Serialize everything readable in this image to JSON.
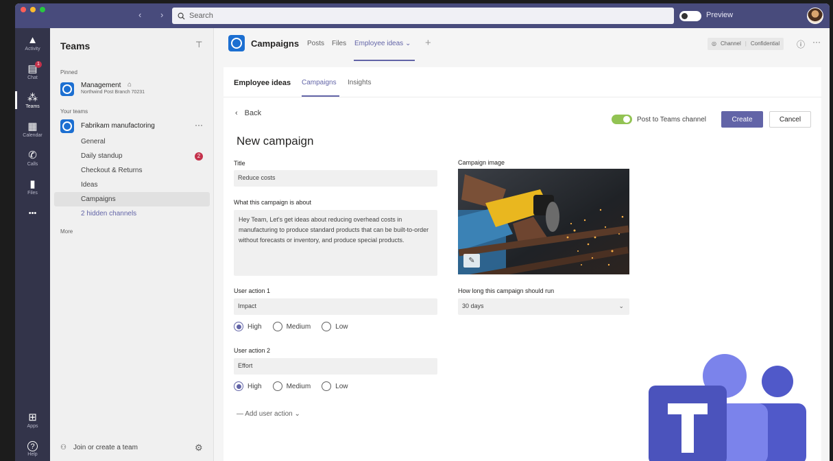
{
  "titlebar": {
    "search_placeholder": "Search",
    "preview_label": "Preview",
    "nav_arrows": "‹ ›"
  },
  "rail": [
    {
      "icon": "bell-icon",
      "glyph": "🔔",
      "label": "Activity"
    },
    {
      "icon": "chat-icon",
      "glyph": "▤",
      "label": "Chat",
      "badge": "1"
    },
    {
      "icon": "teams-icon",
      "glyph": "⁂",
      "label": "Teams"
    },
    {
      "icon": "calendar-icon",
      "glyph": "▦",
      "label": "Calendar"
    },
    {
      "icon": "calls-icon",
      "glyph": "✆",
      "label": "Calls"
    },
    {
      "icon": "files-icon",
      "glyph": "▮",
      "label": "Files"
    },
    {
      "icon": "more-apps-icon",
      "glyph": "•••",
      "label": ""
    },
    {
      "icon": "apps-icon",
      "glyph": "⊞",
      "label": "Apps"
    },
    {
      "icon": "help-icon",
      "glyph": "?",
      "label": "Help"
    }
  ],
  "team_panel": {
    "title": "Teams",
    "pinned_label": "Pinned",
    "pinned_team": {
      "name": "Management",
      "sub": "Northwind Post Branch 70231"
    },
    "your_teams_label": "Your teams",
    "team": {
      "name": "Fabrikam manufactoring",
      "more": "···"
    },
    "channels": [
      {
        "label": "General"
      },
      {
        "label": "Daily standup",
        "badge": "2"
      },
      {
        "label": "Checkout & Returns"
      },
      {
        "label": "Ideas"
      },
      {
        "label": "Campaigns",
        "selected": true
      }
    ],
    "hidden_channels": "2 hidden channels",
    "more_label": "More",
    "join_label": "Join or create a team"
  },
  "channel_header": {
    "title": "Campaigns",
    "tabs": [
      "Posts",
      "Files",
      "Employee ideas"
    ],
    "active_tab": "Employee ideas",
    "confidential": {
      "channel": "Channel",
      "label": "Confidential"
    }
  },
  "app": {
    "title": "Employee ideas",
    "tabs": [
      "Campaigns",
      "Insights"
    ],
    "back_label": "Back",
    "post_to_channel": "Post to Teams channel",
    "create_label": "Create",
    "cancel_label": "Cancel",
    "heading": "New campaign",
    "title_label": "Title",
    "title_value": "Reduce costs",
    "about_label": "What this campaign is about",
    "about_value": "Hey Team, Let's get ideas about reducing overhead costs in manufacturing to produce standard products that can be built-to-order without forecasts or inventory, and produce special products.",
    "image_label": "Campaign image",
    "user_action_1_label": "User action 1",
    "user_action_1_value": "Impact",
    "user_action_2_label": "User action 2",
    "user_action_2_value": "Effort",
    "radio_options": [
      "High",
      "Medium",
      "Low"
    ],
    "radio_selected_1": "High",
    "radio_selected_2": "High",
    "duration_label": "How long this campaign should run",
    "duration_value": "30 days",
    "add_user_action": "Add user action"
  },
  "colors": {
    "brand_purple": "#6264a7",
    "titlebar": "#484b7c",
    "rail": "#33344a",
    "toggle_on": "#92c353",
    "badge_red": "#c4314b"
  }
}
